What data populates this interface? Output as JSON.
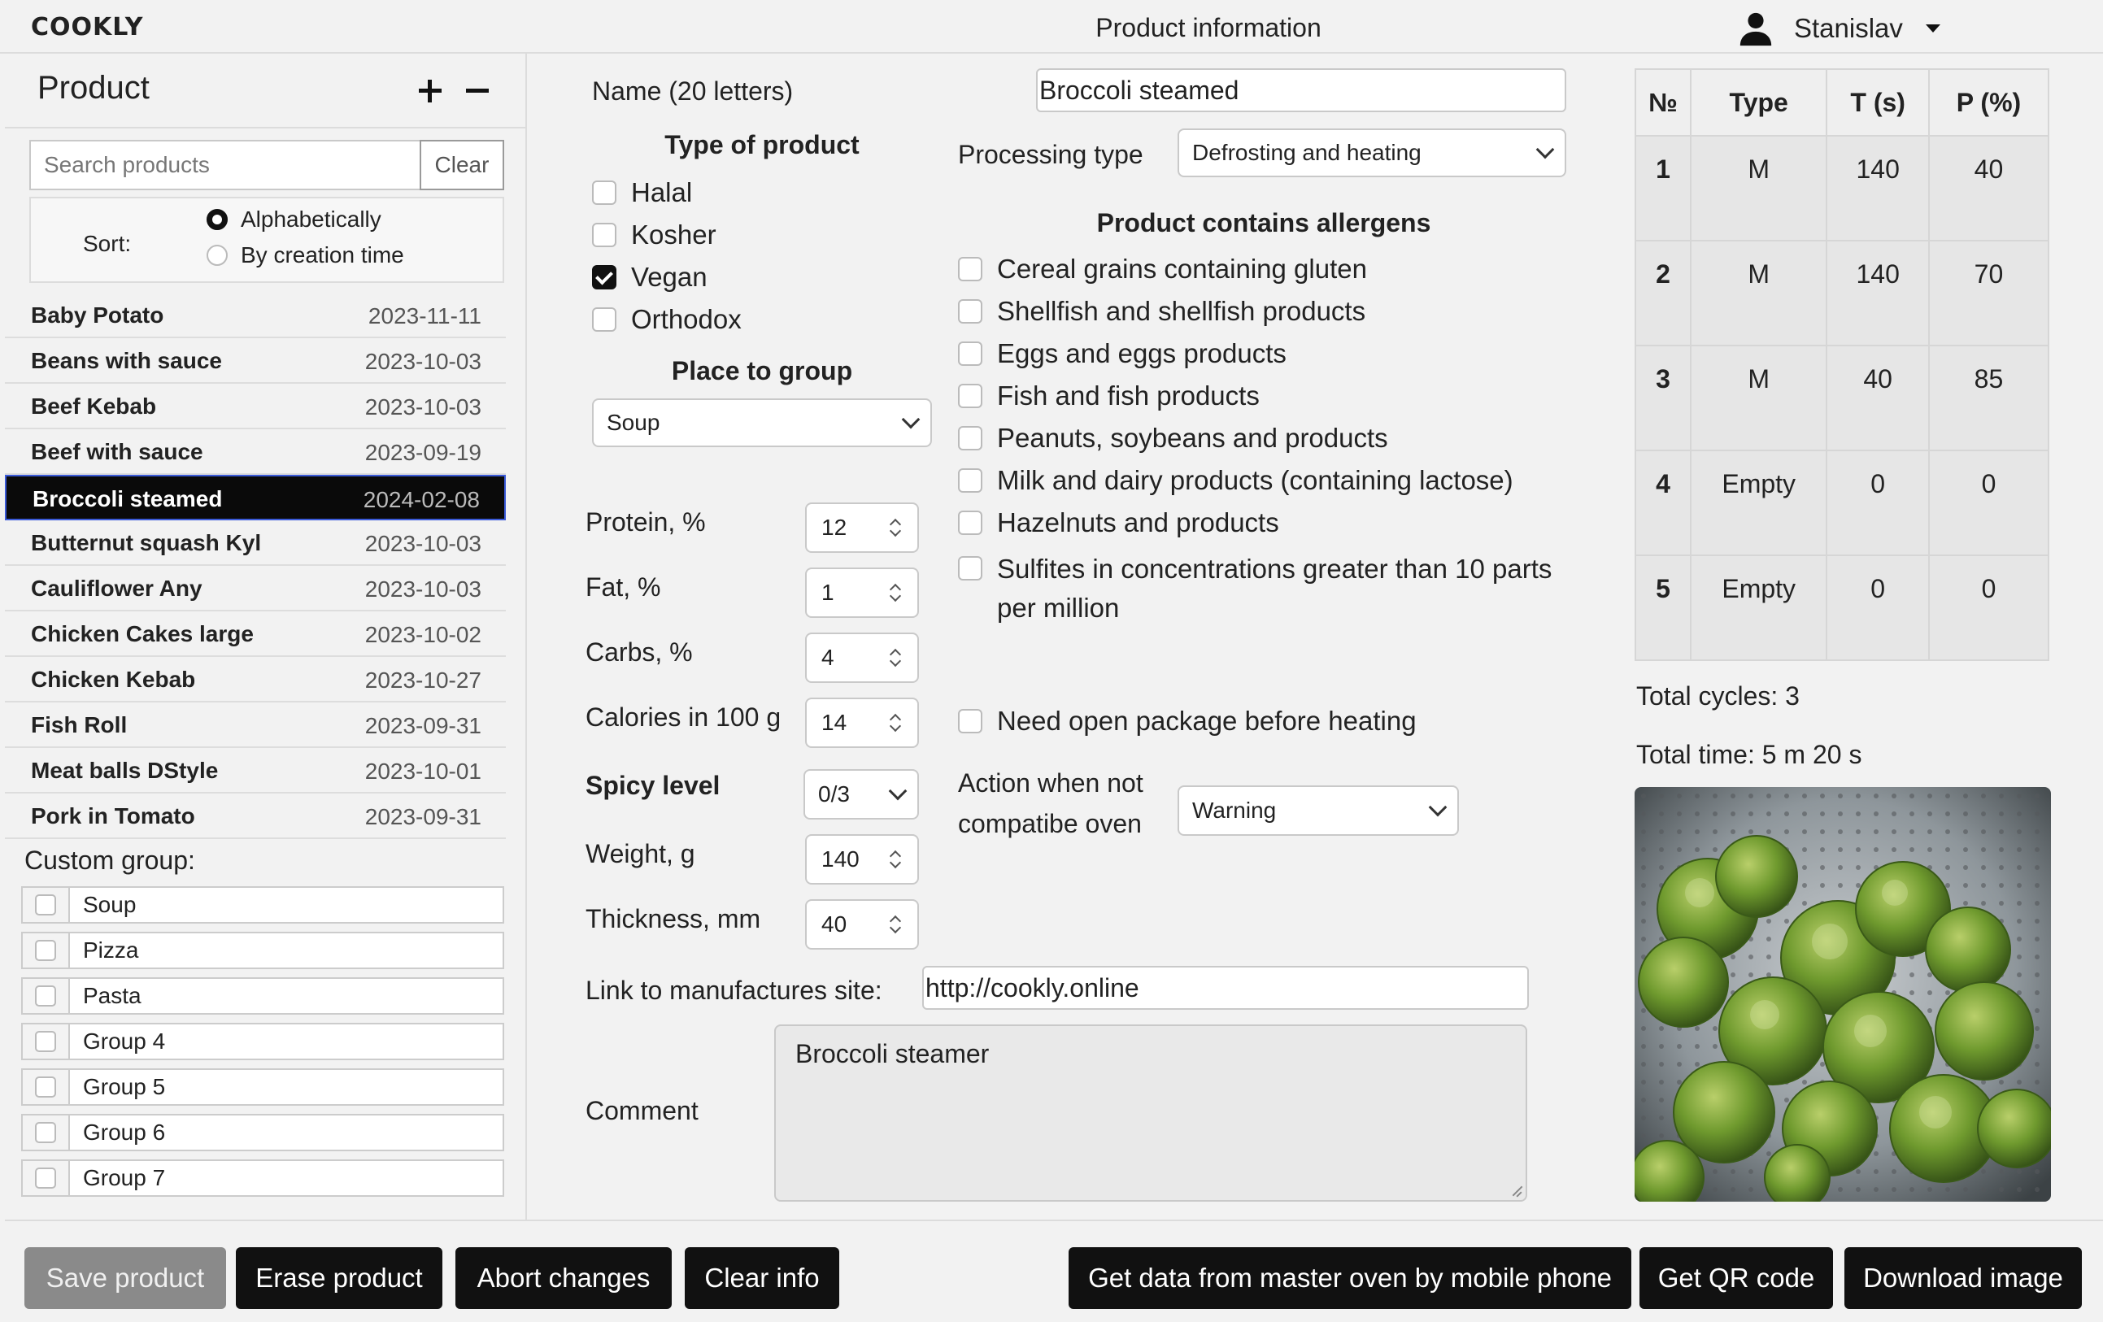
{
  "app": {
    "logo": "COOKLY",
    "page_title": "Product information",
    "user_name": "Stanislav"
  },
  "sidebar": {
    "title": "Product",
    "search_placeholder": "Search products",
    "clear_label": "Clear",
    "sort_label": "Sort:",
    "sort_options": [
      "Alphabetically",
      "By creation time"
    ],
    "sort_selected": "Alphabetically",
    "products": [
      {
        "name": "Baby Potato",
        "date": "2023-11-11"
      },
      {
        "name": "Beans with sauce",
        "date": "2023-10-03"
      },
      {
        "name": "Beef Kebab",
        "date": "2023-10-03"
      },
      {
        "name": "Beef with sauce",
        "date": "2023-09-19"
      },
      {
        "name": "Broccoli steamed",
        "date": "2024-02-08",
        "selected": true
      },
      {
        "name": "Butternut squash Kyl",
        "date": "2023-10-03"
      },
      {
        "name": "Cauliflower Any",
        "date": "2023-10-03"
      },
      {
        "name": "Chicken Cakes large",
        "date": "2023-10-02"
      },
      {
        "name": "Chicken Kebab",
        "date": "2023-10-27"
      },
      {
        "name": "Fish Roll",
        "date": "2023-09-31"
      },
      {
        "name": "Meat balls DStyle",
        "date": "2023-10-01"
      },
      {
        "name": "Pork in Tomato",
        "date": "2023-09-31"
      }
    ],
    "custom_group_label": "Custom group:",
    "custom_groups": [
      "Soup",
      "Pizza",
      "Pasta",
      "Group 4",
      "Group 5",
      "Group 6",
      "Group 7"
    ]
  },
  "form": {
    "name_label": "Name (20 letters)",
    "name_value": "Broccoli steamed",
    "type_heading": "Type of product",
    "types": [
      {
        "label": "Halal",
        "checked": false
      },
      {
        "label": "Kosher",
        "checked": false
      },
      {
        "label": "Vegan",
        "checked": true
      },
      {
        "label": "Orthodox",
        "checked": false
      }
    ],
    "group_heading": "Place to group",
    "group_value": "Soup",
    "processing_label": "Processing type",
    "processing_value": "Defrosting and heating",
    "allergens_heading": "Product contains allergens",
    "allergens": [
      "Cereal grains containing gluten",
      "Shellfish and shellfish products",
      "Eggs and eggs products",
      "Fish and fish products",
      "Peanuts, soybeans and products",
      "Milk and dairy products (containing lactose)",
      "Hazelnuts and products",
      "Sulfites in concentrations greater than 10 parts per million"
    ],
    "protein_label": "Protein, %",
    "protein_value": "12",
    "fat_label": "Fat, %",
    "fat_value": "1",
    "carbs_label": "Carbs, %",
    "carbs_value": "4",
    "calories_label": "Calories in 100 g",
    "calories_value": "14",
    "spicy_label": "Spicy level",
    "spicy_value": "0/3",
    "weight_label": "Weight, g",
    "weight_value": "140",
    "thickness_label": "Thickness, mm",
    "thickness_value": "40",
    "open_package_label": "Need open package before heating",
    "action_label": "Action when not compatibe oven",
    "action_value": "Warning",
    "link_label": "Link to manufactures site:",
    "link_value": "http://cookly.online",
    "comment_label": "Comment",
    "comment_value": "Broccoli steamer"
  },
  "cycles": {
    "headers": [
      "№",
      "Type",
      "T (s)",
      "P (%)"
    ],
    "rows": [
      [
        "1",
        "M",
        "140",
        "40"
      ],
      [
        "2",
        "M",
        "140",
        "70"
      ],
      [
        "3",
        "M",
        "40",
        "85"
      ],
      [
        "4",
        "Empty",
        "0",
        "0"
      ],
      [
        "5",
        "Empty",
        "0",
        "0"
      ]
    ],
    "total_cycles": "Total cycles: 3",
    "total_time": "Total time: 5 m 20 s"
  },
  "actions": {
    "save": "Save product",
    "erase": "Erase product",
    "abort": "Abort changes",
    "clear": "Clear info",
    "master": "Get data from master oven by mobile phone",
    "qr": "Get QR code",
    "download": "Download image"
  }
}
